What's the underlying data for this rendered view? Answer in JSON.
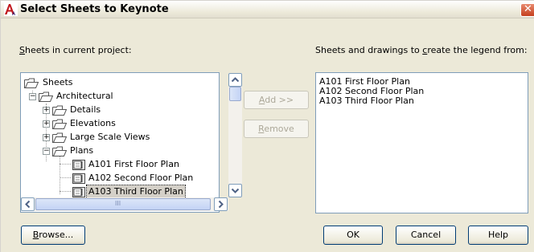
{
  "window": {
    "title": "Select Sheets to Keynote",
    "close_glyph": "✕"
  },
  "left_label": {
    "prefix": "",
    "accel": "S",
    "rest": "heets in current project:"
  },
  "right_label": {
    "before": "Sheets and drawings to ",
    "accel": "c",
    "after": "reate the legend from:"
  },
  "tree": {
    "root": "Sheets",
    "discipline": "Architectural",
    "folders": [
      "Details",
      "Elevations",
      "Large Scale Views",
      "Plans"
    ],
    "sheets": [
      "A101 First Floor Plan",
      "A102 Second Floor Plan",
      "A103 Third Floor Plan"
    ],
    "selected_sheet": "A103 Third Floor Plan",
    "hscroll_grip": "III"
  },
  "mid_buttons": {
    "add": {
      "accel": "A",
      "rest": "dd >>"
    },
    "remove": {
      "accel": "R",
      "rest": "emove"
    }
  },
  "right_list": [
    "A101 First Floor Plan",
    "A102 Second Floor Plan",
    "A103 Third Floor Plan"
  ],
  "bottom_buttons": {
    "browse": {
      "accel": "B",
      "rest": "rowse..."
    },
    "ok": "OK",
    "cancel": "Cancel",
    "help": "Help"
  },
  "colors": {
    "accent": "#003c74",
    "tree_border": "#7f9db9",
    "dialog_bg": "#ece9d8",
    "close": "#c4401e"
  },
  "icons": [
    "autocad-app-icon",
    "folder-icon",
    "sheet-icon",
    "expand-icon",
    "collapse-icon",
    "scroll-arrow-icon"
  ]
}
